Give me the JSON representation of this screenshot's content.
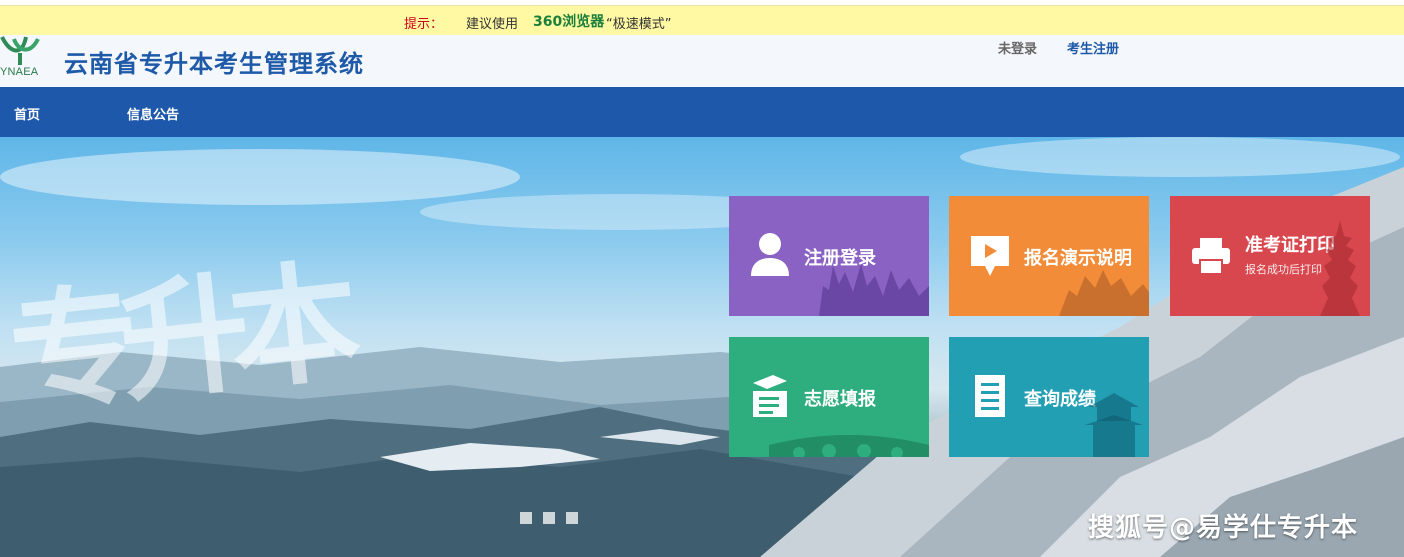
{
  "tipbar": {
    "label": "提示：",
    "text": "建议使用",
    "brand": "360浏览器",
    "mode": "“极速模式”"
  },
  "header": {
    "logo_text": "YNAEA",
    "title": "云南省专升本考生管理系统",
    "login_status": "未登录",
    "register_link": "考生注册"
  },
  "nav": {
    "items": [
      {
        "label": "首页"
      },
      {
        "label": "信息公告"
      }
    ]
  },
  "banner": {
    "watermark": "专升本",
    "source_mark": "搜狐号@易学仕专升本",
    "slides_count": 3
  },
  "tiles": [
    {
      "label": "注册登录",
      "color": "#8a62c4",
      "icon": "user-icon"
    },
    {
      "label": "报名演示说明",
      "color": "#f28c38",
      "icon": "video-play-icon"
    },
    {
      "label": "准考证打印",
      "sublabel": "报名成功后打印",
      "color": "#d9474e",
      "icon": "printer-icon"
    },
    {
      "label": "志愿填报",
      "color": "#2eae7e",
      "icon": "form-icon"
    },
    {
      "label": "查询成绩",
      "color": "#239fb4",
      "icon": "document-list-icon"
    }
  ],
  "colors": {
    "nav_bg": "#1e58aa",
    "title": "#1e5aa8",
    "tipbar_bg": "#fff9a3"
  }
}
